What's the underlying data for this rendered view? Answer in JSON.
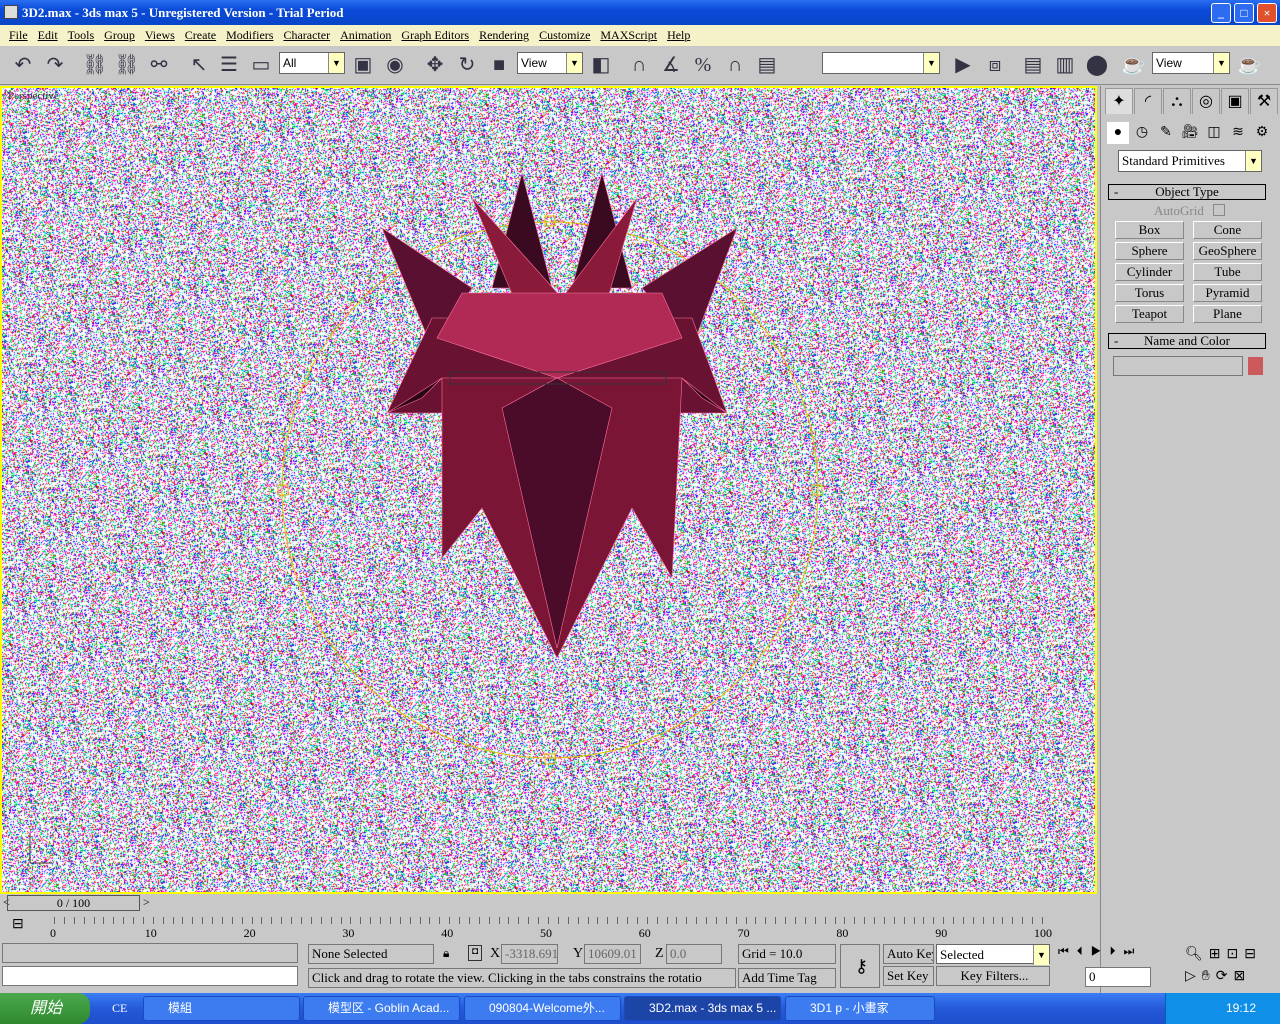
{
  "window": {
    "title": "3D2.max - 3ds max 5 - Unregistered Version - Trial Period",
    "minimize": "_",
    "maximize": "□",
    "close": "×"
  },
  "menu": [
    "File",
    "Edit",
    "Tools",
    "Group",
    "Views",
    "Create",
    "Modifiers",
    "Character",
    "Animation",
    "Graph Editors",
    "Rendering",
    "Customize",
    "MAXScript",
    "Help"
  ],
  "toolbar": {
    "selection_filter": "All",
    "ref_coord": "View",
    "named_selection": "",
    "render_view": "View",
    "icons": [
      "undo-icon",
      "redo-icon",
      "select-link-icon",
      "unlink-icon",
      "bind-spacewarp-icon",
      "select-icon",
      "select-by-name-icon",
      "rect-region-icon",
      "window-crossing-icon",
      "select-manipulate-icon",
      "move-icon",
      "rotate-icon",
      "scale-icon",
      "pivot-icon",
      "snap-3d-icon",
      "angle-snap-icon",
      "percent-snap-icon",
      "spinner-snap-icon",
      "edit-named-sel-icon",
      "mirror-icon",
      "align-icon",
      "track-view-icon",
      "schematic-icon",
      "material-editor-icon",
      "render-scene-icon",
      "quick-render-icon"
    ]
  },
  "viewport": {
    "label": "Perspective",
    "object_color": "#8a1a3a",
    "border_color": "#ffff00"
  },
  "command_panel": {
    "tabs": [
      "create-icon",
      "modify-icon",
      "hierarchy-icon",
      "motion-icon",
      "display-icon",
      "utilities-icon"
    ],
    "categories": [
      "geometry-icon",
      "shapes-icon",
      "lights-icon",
      "cameras-icon",
      "helpers-icon",
      "spacewarps-icon",
      "systems-icon"
    ],
    "dropdown": "Standard Primitives",
    "object_type": {
      "title": "Object Type",
      "collapse": "-",
      "autogrid": "AutoGrid",
      "buttons": [
        "Box",
        "Cone",
        "Sphere",
        "GeoSphere",
        "Cylinder",
        "Tube",
        "Torus",
        "Pyramid",
        "Teapot",
        "Plane"
      ]
    },
    "name_color": {
      "title": "Name and Color",
      "collapse": "-",
      "name": "",
      "color": "#cc5a5a"
    }
  },
  "time_slider": {
    "label": "0 / 100",
    "prev": "<",
    "next": ">",
    "current": 0,
    "max": 100
  },
  "trackbar": {
    "labels": [
      "0",
      "10",
      "20",
      "30",
      "40",
      "50",
      "60",
      "70",
      "80",
      "90",
      "100"
    ]
  },
  "status": {
    "selection": "None Selected",
    "x_label": "X",
    "x": "-3318.691",
    "y_label": "Y",
    "y": "10609.01",
    "z_label": "Z",
    "z": "0.0",
    "grid": "Grid = 10.0",
    "prompt": "Click and drag to rotate the view.  Clicking in the tabs constrains the rotatio",
    "add_time_tag": "Add Time Tag",
    "auto_key": "Auto Key",
    "set_key": "Set Key",
    "key_mode": "Selected",
    "key_filters": "Key Filters...",
    "frame": "0"
  },
  "taskbar": {
    "start": "開始",
    "quicklaunch": "CE",
    "tasks": [
      "模組",
      "模型区 - Goblin Acad...",
      "090804-Welcome外...",
      "3D2.max - 3ds max 5 ...",
      "3D1 p - 小畫家"
    ],
    "active": 3,
    "clock": "19:12"
  }
}
